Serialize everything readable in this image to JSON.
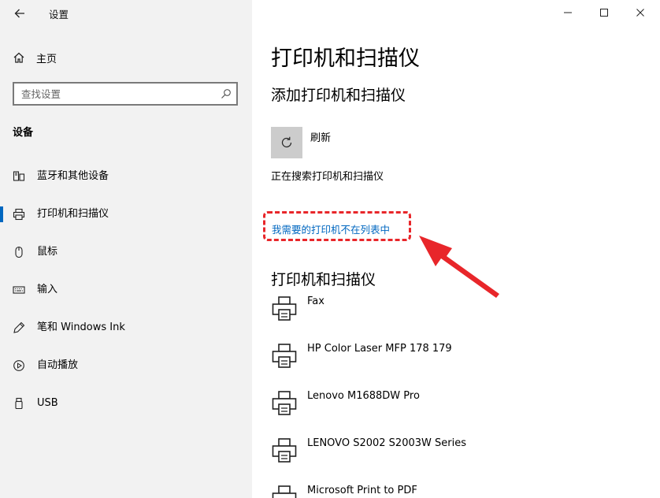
{
  "window": {
    "title": "设置",
    "back_icon": "arrow-left-icon",
    "controls": [
      "minimize-icon",
      "maximize-icon",
      "close-icon"
    ]
  },
  "sidebar": {
    "home_label": "主页",
    "search_placeholder": "查找设置",
    "section_label": "设备",
    "items": [
      {
        "label": "蓝牙和其他设备",
        "icon": "bluetooth-devices-icon",
        "selected": false
      },
      {
        "label": "打印机和扫描仪",
        "icon": "printer-icon",
        "selected": true
      },
      {
        "label": "鼠标",
        "icon": "mouse-icon",
        "selected": false
      },
      {
        "label": "输入",
        "icon": "keyboard-icon",
        "selected": false
      },
      {
        "label": "笔和 Windows Ink",
        "icon": "pen-icon",
        "selected": false
      },
      {
        "label": "自动播放",
        "icon": "autoplay-icon",
        "selected": false
      },
      {
        "label": "USB",
        "icon": "usb-icon",
        "selected": false
      }
    ]
  },
  "main": {
    "title": "打印机和扫描仪",
    "add_section_title": "添加打印机和扫描仪",
    "refresh_label": "刷新",
    "searching_text": "正在搜索打印机和扫描仪",
    "not_listed_link": "我需要的打印机不在列表中",
    "printers_section_title": "打印机和扫描仪",
    "printers": [
      {
        "name": "Fax"
      },
      {
        "name": "HP Color Laser MFP 178 179"
      },
      {
        "name": "Lenovo M1688DW Pro"
      },
      {
        "name": "LENOVO S2002 S2003W Series"
      },
      {
        "name": "Microsoft Print to PDF"
      }
    ]
  },
  "colors": {
    "accent": "#0067c0",
    "annotation_red": "#e8262a",
    "sidebar_bg": "#f2f2f2"
  }
}
